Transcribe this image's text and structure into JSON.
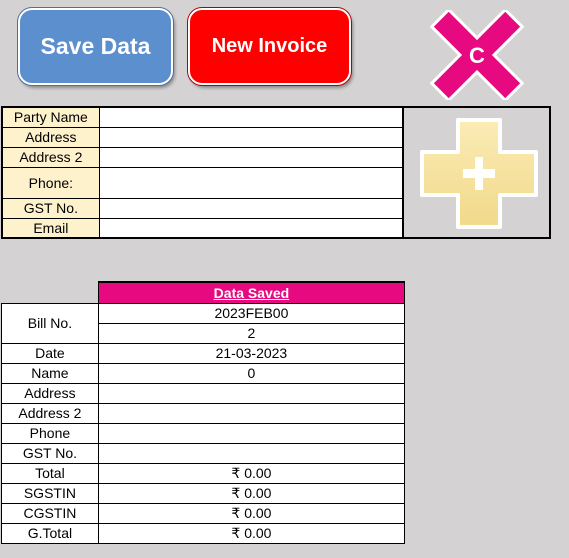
{
  "buttons": {
    "save_label": "Save Data",
    "new_label": "New Invoice",
    "clear_letter": "C"
  },
  "party_form": {
    "labels": [
      "Party Name",
      "Address",
      "Address 2",
      "Phone:",
      "GST No.",
      "Email"
    ],
    "values": [
      "",
      "",
      "",
      "",
      "",
      ""
    ]
  },
  "bill": {
    "status": "Data Saved",
    "rows": [
      {
        "label": "Bill No.",
        "value": "2023FEB00"
      },
      {
        "label": "",
        "value": "2"
      },
      {
        "label": "Date",
        "value": "21-03-2023"
      },
      {
        "label": "Name",
        "value": "0"
      },
      {
        "label": "Address",
        "value": ""
      },
      {
        "label": "Address 2",
        "value": ""
      },
      {
        "label": "Phone",
        "value": ""
      },
      {
        "label": "GST No.",
        "value": ""
      },
      {
        "label": "Total",
        "value": "₹ 0.00"
      },
      {
        "label": "SGSTIN",
        "value": "₹ 0.00"
      },
      {
        "label": "CGSTIN",
        "value": "₹ 0.00"
      },
      {
        "label": "G.Total",
        "value": "₹ 0.00"
      }
    ]
  },
  "icons": {
    "clear": "clear-x-icon",
    "add": "add-plus-icon"
  },
  "colors": {
    "save_button": "#5b8fcd",
    "new_button": "#ff0000",
    "header_magenta": "#e6097f",
    "label_fill": "#fef2cc",
    "background": "#d4d2d3",
    "plus_fill": "#f8e39f"
  }
}
